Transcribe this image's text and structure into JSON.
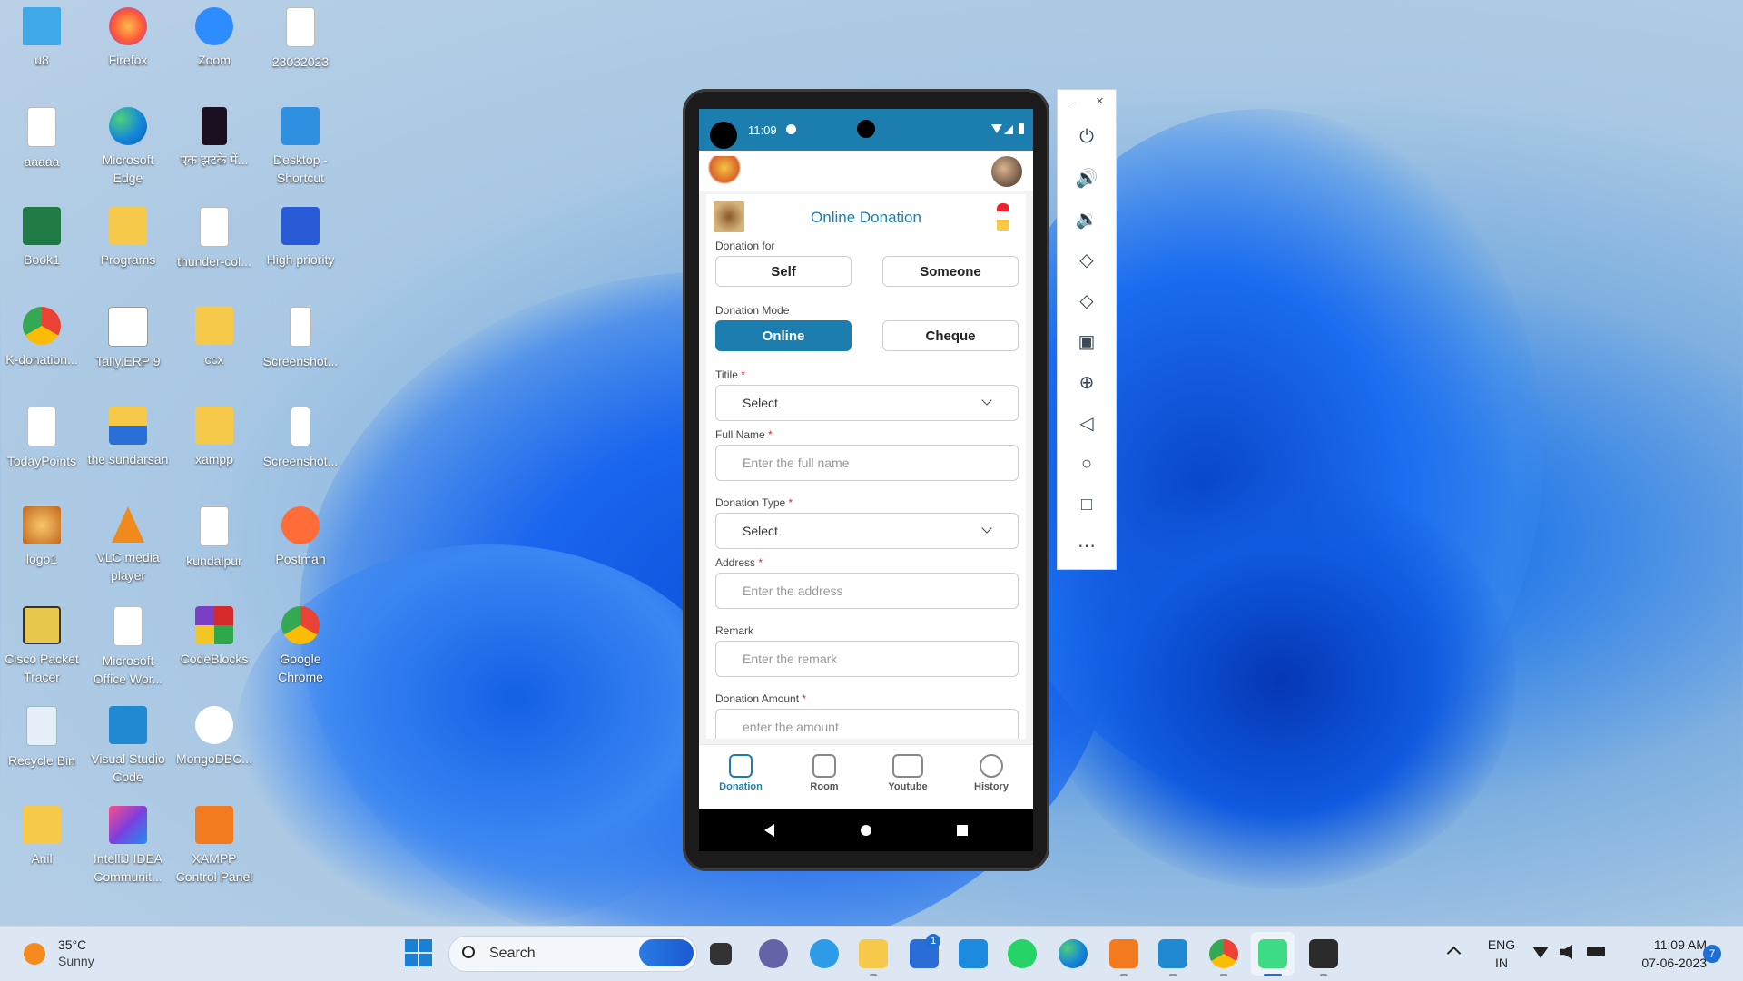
{
  "desktop": {
    "icons": [
      {
        "label": "u8"
      },
      {
        "label": "Firefox"
      },
      {
        "label": "Zoom"
      },
      {
        "label": "23032023"
      },
      {
        "label": "aaaaa"
      },
      {
        "label": "Microsoft Edge"
      },
      {
        "label": "एक झटके में..."
      },
      {
        "label": "Desktop - Shortcut"
      },
      {
        "label": "Book1"
      },
      {
        "label": "Programs"
      },
      {
        "label": "thunder-col..."
      },
      {
        "label": "High priority"
      },
      {
        "label": "K-donation..."
      },
      {
        "label": "Tally.ERP 9"
      },
      {
        "label": "ccx"
      },
      {
        "label": "Screenshot..."
      },
      {
        "label": "TodayPoints"
      },
      {
        "label": "the sundarsan"
      },
      {
        "label": "xampp"
      },
      {
        "label": "Screenshot..."
      },
      {
        "label": "logo1"
      },
      {
        "label": "VLC media player"
      },
      {
        "label": "kundalpur"
      },
      {
        "label": "Postman"
      },
      {
        "label": "Cisco Packet Tracer"
      },
      {
        "label": "Microsoft Office Wor..."
      },
      {
        "label": "CodeBlocks"
      },
      {
        "label": "Google Chrome"
      },
      {
        "label": "Recycle Bin"
      },
      {
        "label": "Visual Studio Code"
      },
      {
        "label": "MongoDBC..."
      },
      {
        "label": ""
      },
      {
        "label": "Anil"
      },
      {
        "label": "IntelliJ IDEA Communit..."
      },
      {
        "label": "XAMPP Control Panel"
      },
      {
        "label": ""
      }
    ]
  },
  "phone": {
    "status": {
      "time": "11:09"
    },
    "form": {
      "title": "Online Donation",
      "donation_for_label": "Donation for",
      "self_label": "Self",
      "someone_label": "Someone",
      "donation_mode_label": "Donation Mode",
      "online_label": "Online",
      "cheque_label": "Cheque",
      "title_label": "Titile",
      "title_select": "Select",
      "full_name_label": "Full Name",
      "full_name_placeholder": "Enter the full name",
      "donation_type_label": "Donation Type",
      "donation_type_select": "Select",
      "address_label": "Address",
      "address_placeholder": "Enter the address",
      "remark_label": "Remark",
      "remark_placeholder": "Enter the remark",
      "amount_label": "Donation Amount",
      "amount_placeholder": "enter the amount",
      "required_mark": "*"
    },
    "nav": [
      {
        "label": "Donation"
      },
      {
        "label": "Room"
      },
      {
        "label": "Youtube"
      },
      {
        "label": "History"
      }
    ]
  },
  "emulator_toolbar": {
    "minimize": "–",
    "close": "×",
    "buttons": [
      "power-icon",
      "volume-up-icon",
      "volume-down-icon",
      "rotate-left-icon",
      "rotate-right-icon",
      "camera-icon",
      "zoom-icon",
      "back-icon",
      "home-icon",
      "overview-icon",
      "more-icon"
    ]
  },
  "taskbar": {
    "weather_temp": "35°C",
    "weather_desc": "Sunny",
    "search_label": "Search",
    "lang_top": "ENG",
    "lang_bottom": "IN",
    "time": "11:09 AM",
    "date": "07-06-2023",
    "notification_count": "7",
    "store_badge": "1"
  }
}
